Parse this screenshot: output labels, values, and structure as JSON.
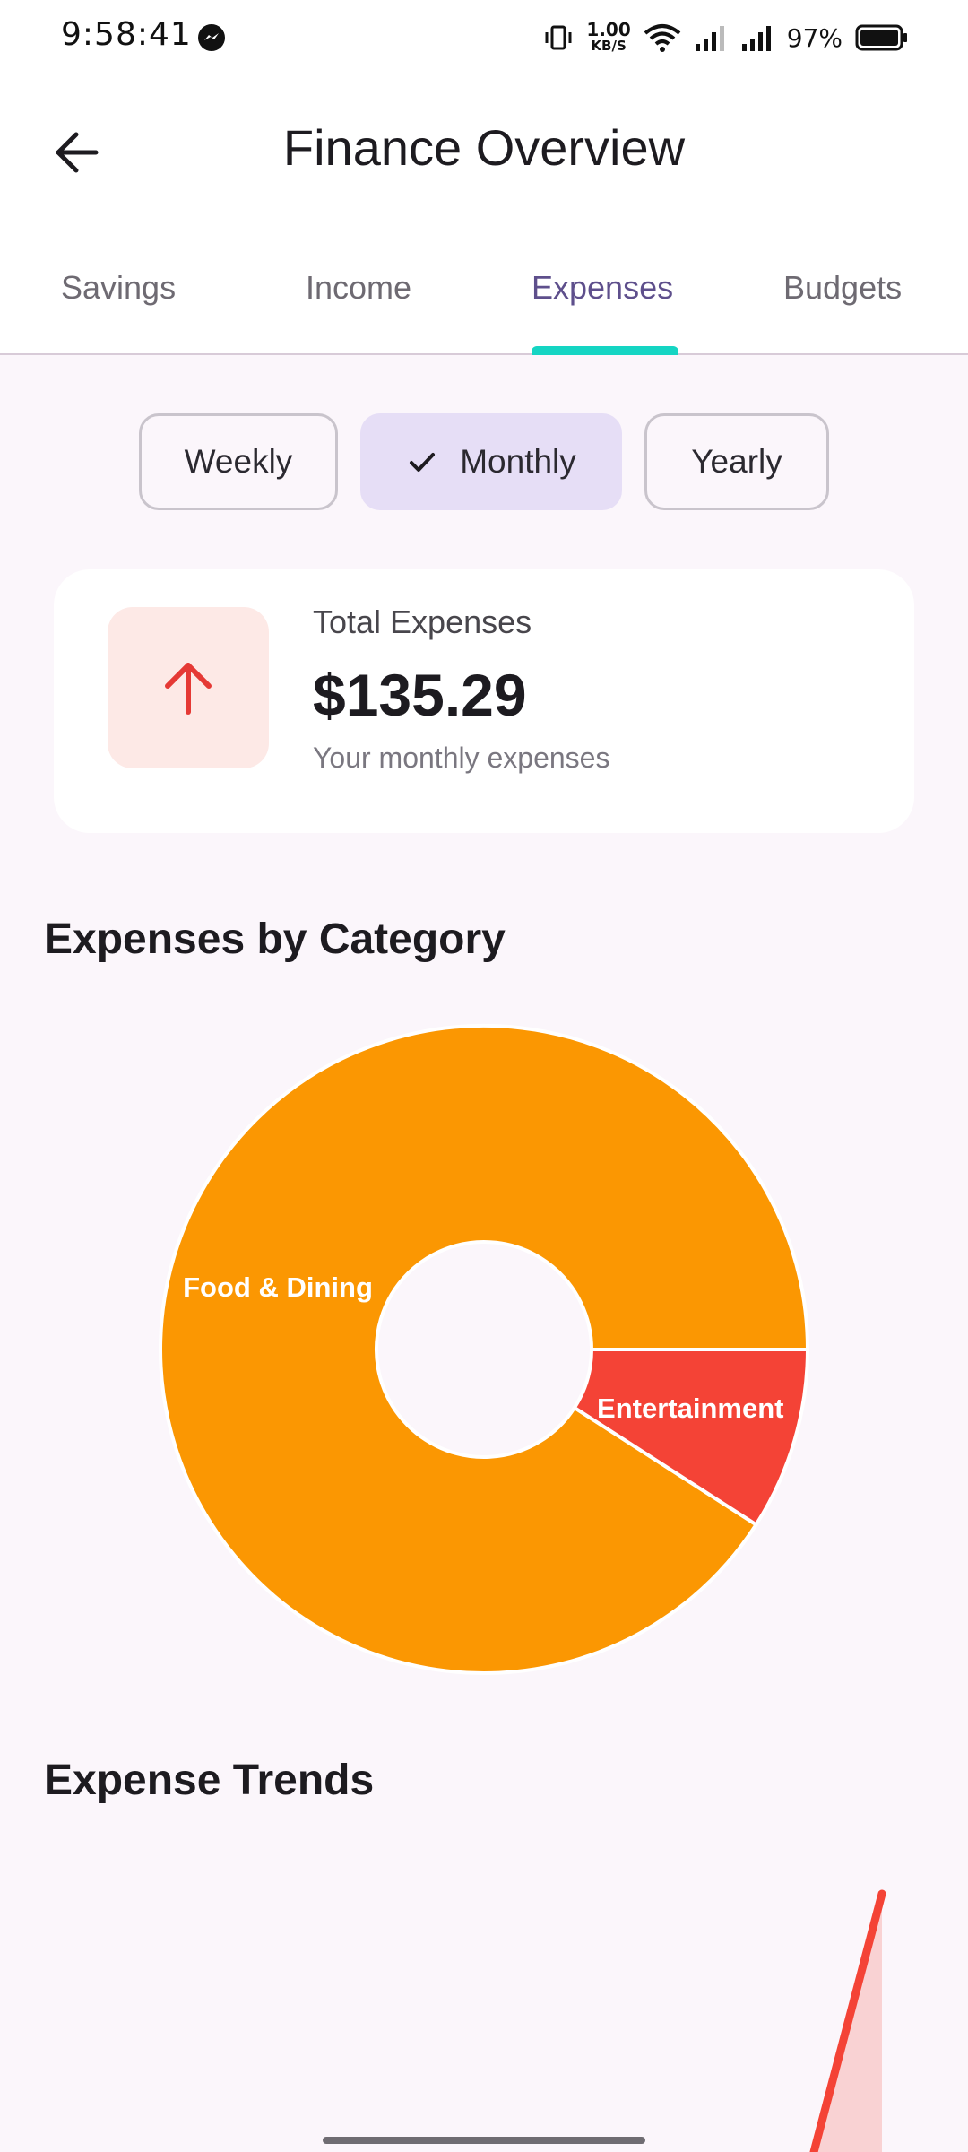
{
  "status_bar": {
    "time": "9:58:41",
    "net_speed_value": "1.00",
    "net_speed_unit": "KB/S",
    "battery": "97%"
  },
  "header": {
    "title": "Finance Overview",
    "back_icon": "arrow-left-icon"
  },
  "tabs": [
    {
      "label": "Savings",
      "active": false
    },
    {
      "label": "Income",
      "active": false
    },
    {
      "label": "Expenses",
      "active": true
    },
    {
      "label": "Budgets",
      "active": false
    }
  ],
  "periods": [
    {
      "label": "Weekly",
      "selected": false
    },
    {
      "label": "Monthly",
      "selected": true
    },
    {
      "label": "Yearly",
      "selected": false
    }
  ],
  "summary": {
    "label": "Total Expenses",
    "amount": "$135.29",
    "subtitle": "Your monthly expenses",
    "icon": "arrow-up-icon",
    "icon_color": "#e53935",
    "icon_bg": "#fde9e6"
  },
  "category_section": {
    "title": "Expenses by Category"
  },
  "trends_section": {
    "title": "Expense Trends"
  },
  "chart_data": [
    {
      "type": "pie",
      "title": "Expenses by Category",
      "donut": true,
      "categories": [
        "Food & Dining",
        "Entertainment"
      ],
      "values": [
        90.9,
        9.1
      ],
      "colors": [
        "#fb9702",
        "#f44336"
      ]
    },
    {
      "type": "area",
      "title": "Expense Trends",
      "series": [
        {
          "values": [
            0,
            135.29
          ],
          "color": "#f44336",
          "fill": "#f9d2d3"
        }
      ]
    }
  ],
  "colors": {
    "accent": "#15d5c3",
    "active_tab": "#5e4f8c",
    "chip_selected": "#e6def6",
    "background": "#fbf6fb"
  }
}
